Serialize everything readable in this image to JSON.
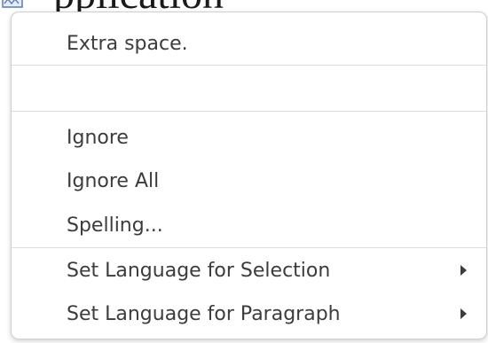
{
  "document": {
    "visible_text": "pplication"
  },
  "context_menu": {
    "suggestion": "Extra space.",
    "blank_item": "",
    "ignore": "Ignore",
    "ignore_all": "Ignore All",
    "spelling": "Spelling...",
    "set_language_selection": "Set Language for Selection",
    "set_language_paragraph": "Set Language for Paragraph"
  },
  "icons": {
    "document_icon": "spelling-check-icon",
    "submenu_arrow": "chevron-right-icon"
  },
  "colors": {
    "menu_background": "#ffffff",
    "menu_text": "#3c3c3c",
    "separator": "#dcdcdc",
    "menu_border": "#cfcfcf"
  }
}
